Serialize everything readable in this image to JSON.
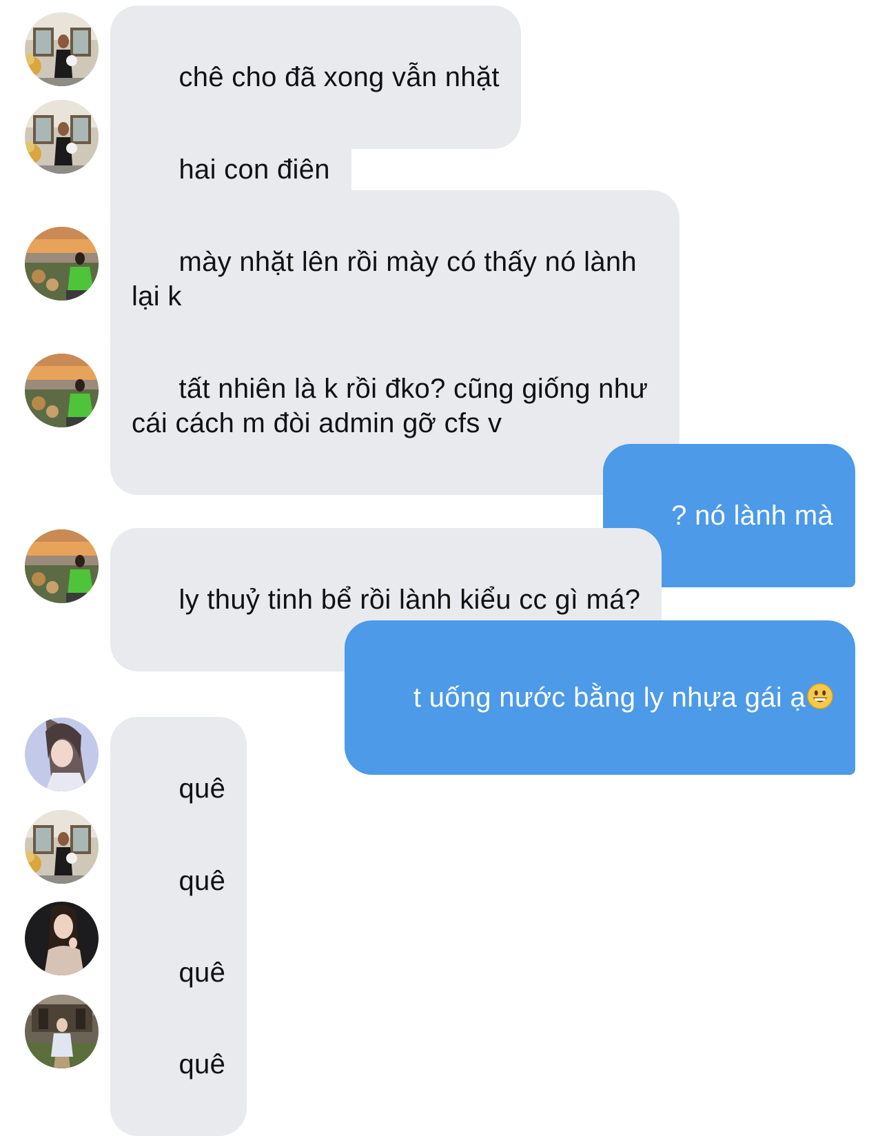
{
  "conversation": {
    "messages": [
      {
        "sender": "other",
        "avatar": "avatar-a",
        "text": "chê cho đã xong vẫn nhặt"
      },
      {
        "sender": "other",
        "avatar": "avatar-a",
        "text": "hai con điên"
      },
      {
        "sender": "other",
        "avatar": "avatar-b",
        "text": "mày nhặt lên rồi mày có thấy nó lành\nlại k"
      },
      {
        "sender": "other",
        "avatar": "avatar-b",
        "text": "tất nhiên là k rồi đko? cũng giống như\ncái cách m đòi admin gỡ cfs v"
      },
      {
        "sender": "self",
        "text": "? nó lành mà"
      },
      {
        "sender": "other",
        "avatar": "avatar-b",
        "text": "ly thuỷ tinh bể rồi lành kiểu cc gì má?"
      },
      {
        "sender": "self",
        "text": "t uống nước bằng ly nhựa gái ạ",
        "emoji": "grinning-face"
      },
      {
        "sender": "other",
        "avatar": "avatar-c",
        "text": "quê"
      },
      {
        "sender": "other",
        "avatar": "avatar-a",
        "text": "quê"
      },
      {
        "sender": "other",
        "avatar": "avatar-d",
        "text": "quê"
      },
      {
        "sender": "other",
        "avatar": "avatar-e",
        "text": "quê"
      }
    ]
  },
  "colors": {
    "incoming_bubble": "#e9eaee",
    "outgoing_bubble": "#4c9ae8",
    "incoming_text": "#111111",
    "outgoing_text": "#ffffff"
  }
}
